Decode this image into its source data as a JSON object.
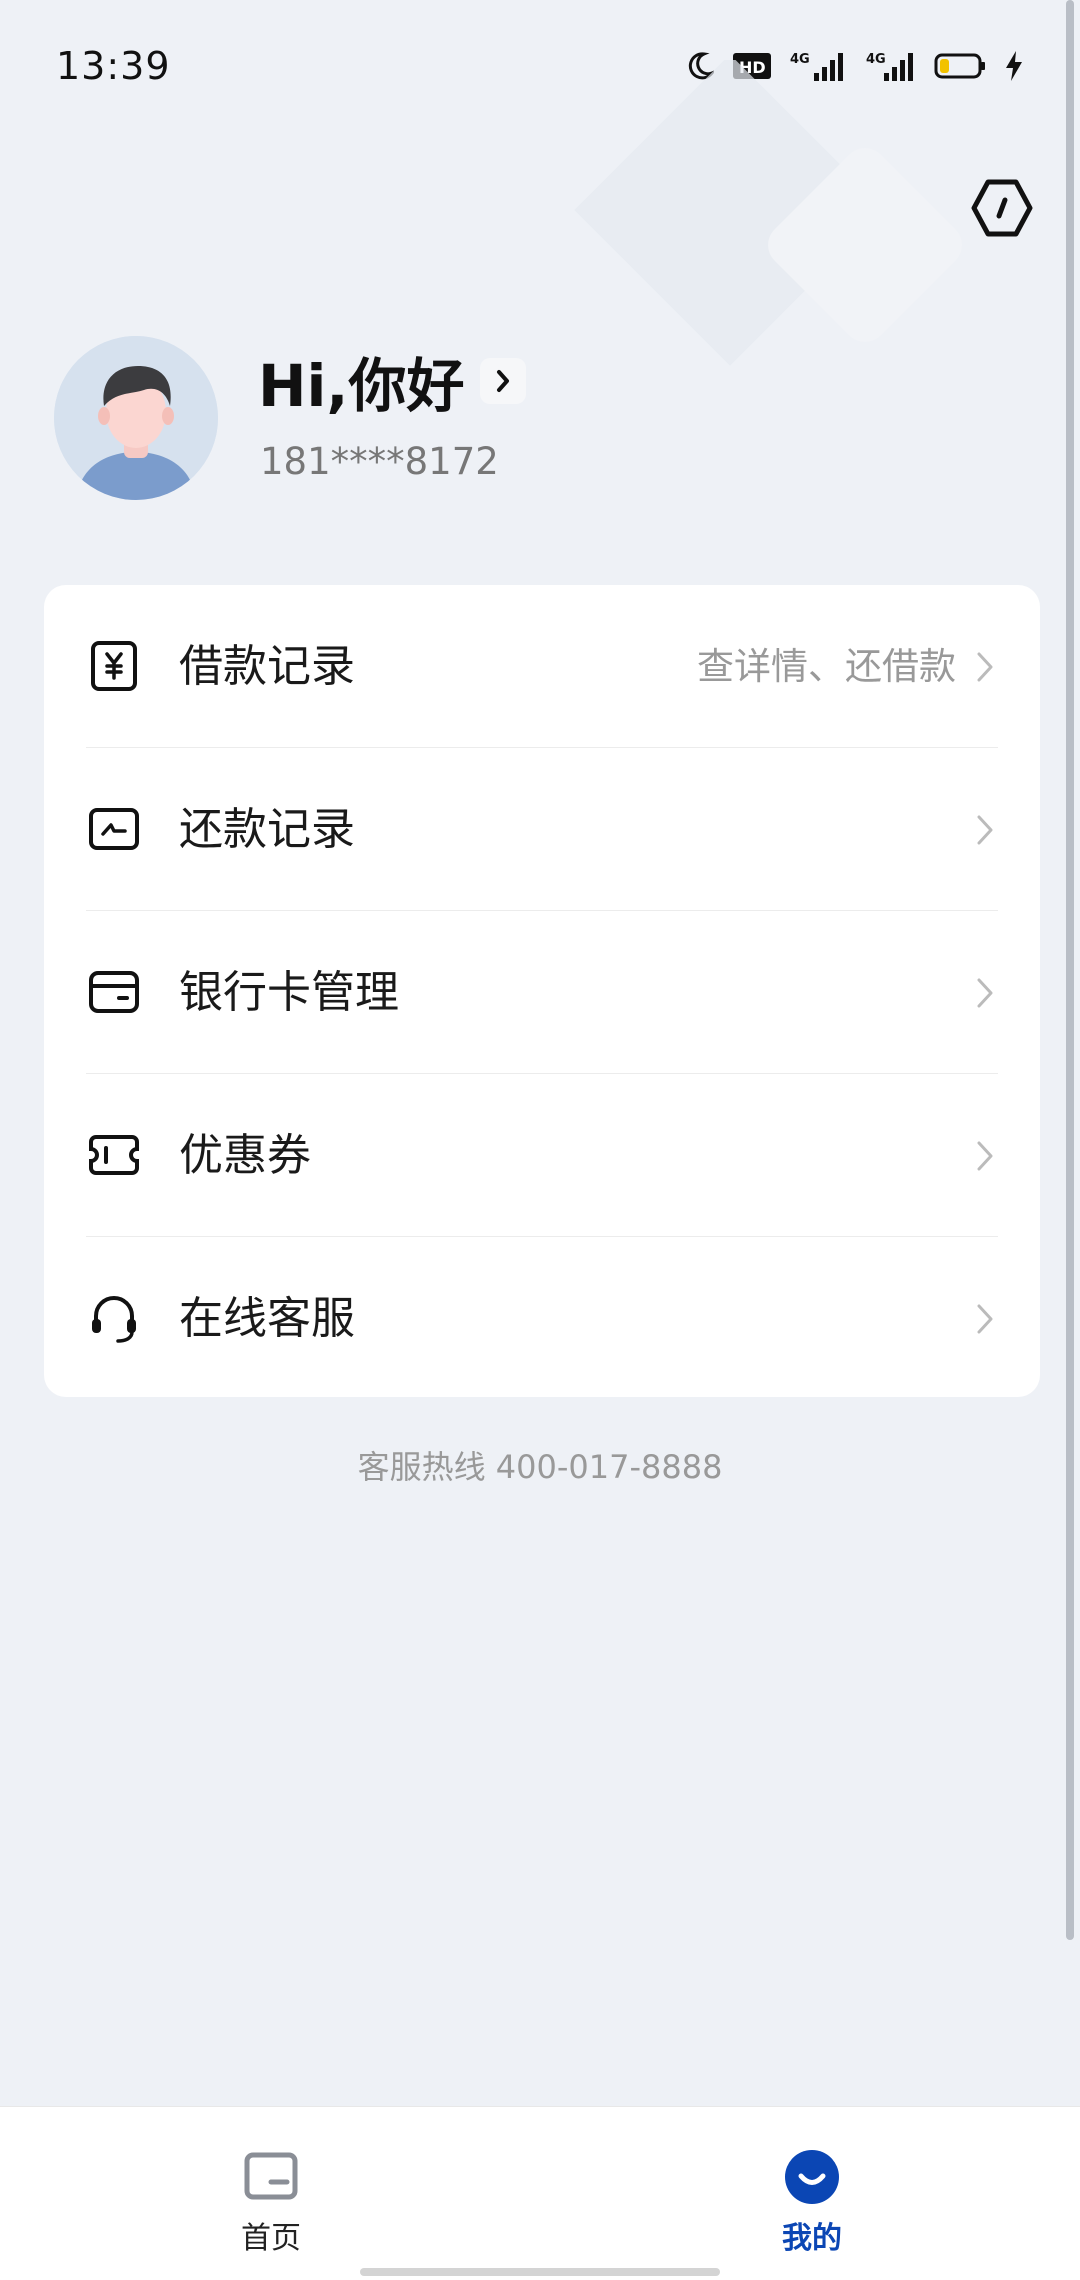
{
  "status_bar": {
    "time": "13:39",
    "icons": [
      "moon-icon",
      "hd-icon",
      "signal-4g-icon",
      "signal-4g-icon",
      "battery-icon",
      "charging-icon"
    ],
    "hd_label": "HD",
    "net1_label": "4G",
    "net2_label": "4G"
  },
  "header": {
    "settings_icon": "settings-hex-icon"
  },
  "profile": {
    "greeting": "Hi,你好",
    "phone": "181****8172"
  },
  "menu": {
    "items": [
      {
        "label": "借款记录",
        "sub": "查详情、还借款",
        "icon": "yen-receipt-icon"
      },
      {
        "label": "还款记录",
        "sub": "",
        "icon": "repay-card-icon"
      },
      {
        "label": "银行卡管理",
        "sub": "",
        "icon": "bank-card-icon"
      },
      {
        "label": "优惠券",
        "sub": "",
        "icon": "coupon-icon"
      },
      {
        "label": "在线客服",
        "sub": "",
        "icon": "headset-icon"
      }
    ]
  },
  "hotline": "客服热线 400-017-8888",
  "bottom_nav": {
    "home_label": "首页",
    "mine_label": "我的",
    "active": "mine",
    "accent": "#0b46b4"
  }
}
